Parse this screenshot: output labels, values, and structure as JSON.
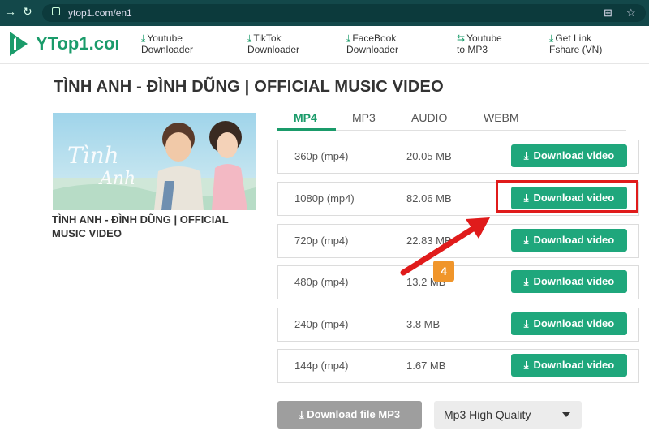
{
  "browser": {
    "url": "ytop1.com/en1"
  },
  "site": {
    "logo_text": "YTop1.coı",
    "nav": [
      {
        "line1": "Youtube",
        "line2": "Downloader",
        "icon": "download-icon"
      },
      {
        "line1": "TikTok",
        "line2": "Downloader",
        "icon": "download-icon"
      },
      {
        "line1": "FaceBook",
        "line2": "Downloader",
        "icon": "download-icon"
      },
      {
        "line1": "Youtube",
        "line2": "to MP3",
        "icon": "convert-icon"
      },
      {
        "line1": "Get Link",
        "line2": "Fshare (VN)",
        "icon": "download-icon"
      }
    ]
  },
  "video": {
    "title": "TÌNH ANH - ĐÌNH DŨNG | OFFICIAL MUSIC VIDEO",
    "caption": "TÌNH ANH - ĐÌNH DŨNG | OFFICIAL MUSIC VIDEO"
  },
  "tabs": [
    "MP4",
    "MP3",
    "AUDIO",
    "WEBM"
  ],
  "active_tab": "MP4",
  "download_label": "Download video",
  "rows": [
    {
      "quality": "360p (mp4)",
      "size": "20.05 MB"
    },
    {
      "quality": "1080p (mp4)",
      "size": "82.06 MB"
    },
    {
      "quality": "720p (mp4)",
      "size": "22.83 MB"
    },
    {
      "quality": "480p (mp4)",
      "size": "13.2 MB"
    },
    {
      "quality": "240p (mp4)",
      "size": "3.8 MB"
    },
    {
      "quality": "144p (mp4)",
      "size": "1.67 MB"
    }
  ],
  "step_badge": "4",
  "bottom": {
    "mp3_button": "Download file MP3",
    "quality_select": "Mp3 High Quality"
  },
  "colors": {
    "accent": "#1fa77c",
    "highlight": "#e01b1b",
    "badge": "#f0952a",
    "browser": "#13484a"
  }
}
